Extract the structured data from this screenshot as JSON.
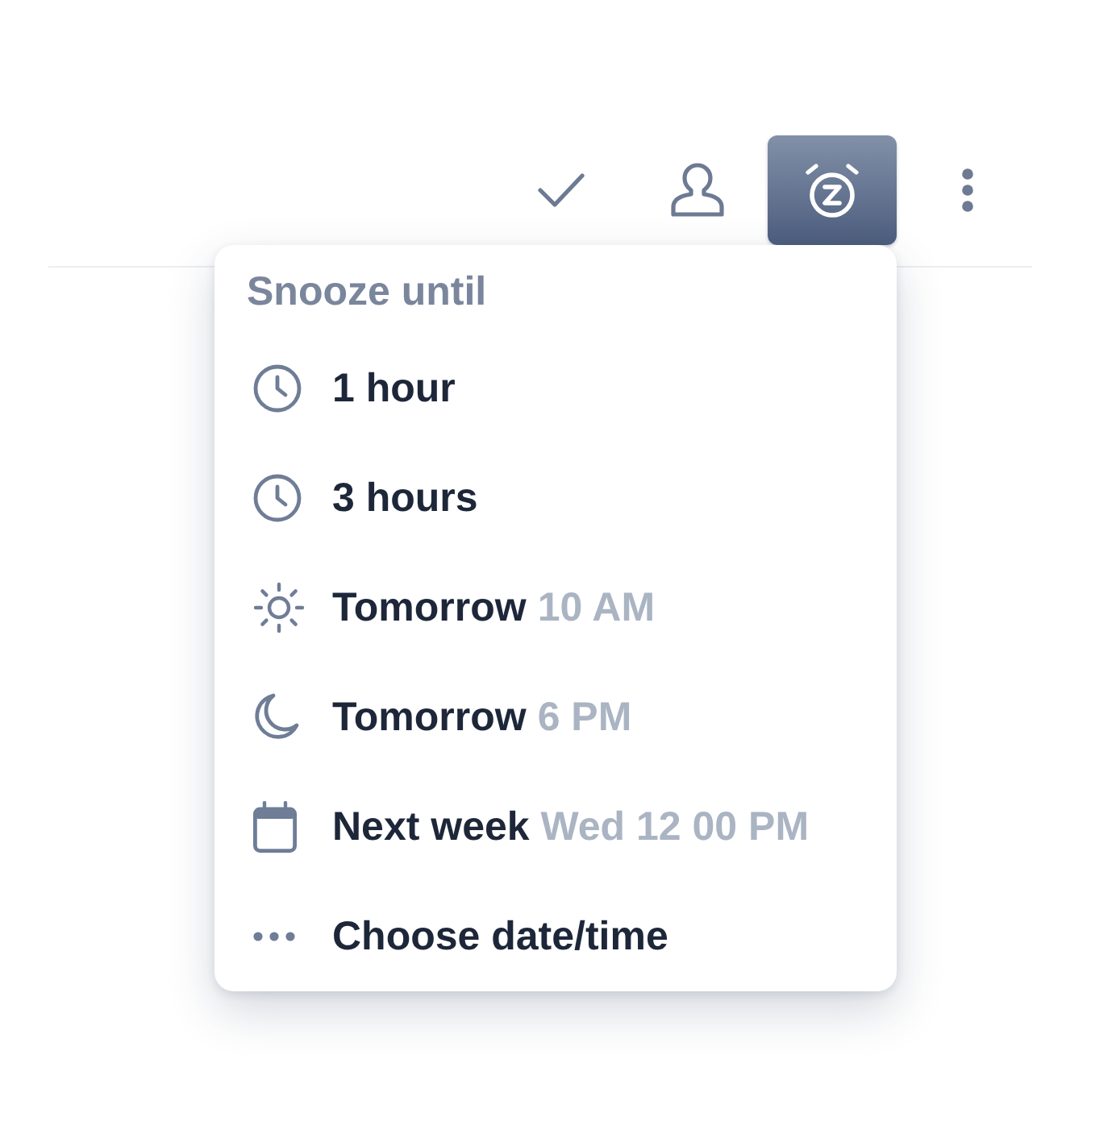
{
  "toolbar": {
    "buttons": [
      {
        "kind": "check",
        "selected": false
      },
      {
        "kind": "person",
        "selected": false
      },
      {
        "kind": "snooze",
        "selected": true
      },
      {
        "kind": "more",
        "selected": false
      }
    ]
  },
  "snooze_menu": {
    "title": "Snooze until",
    "options": [
      {
        "kind": "clock",
        "label": "1 hour"
      },
      {
        "kind": "clock",
        "label": "3 hours"
      },
      {
        "kind": "sun",
        "label": "Tomorrow",
        "detail": "10 AM"
      },
      {
        "kind": "moon",
        "label": "Tomorrow",
        "detail": "6 PM"
      },
      {
        "kind": "calendar",
        "label": "Next week",
        "detail": "Wed 12 00 PM"
      },
      {
        "kind": "dots",
        "label": "Choose date/time"
      }
    ]
  }
}
